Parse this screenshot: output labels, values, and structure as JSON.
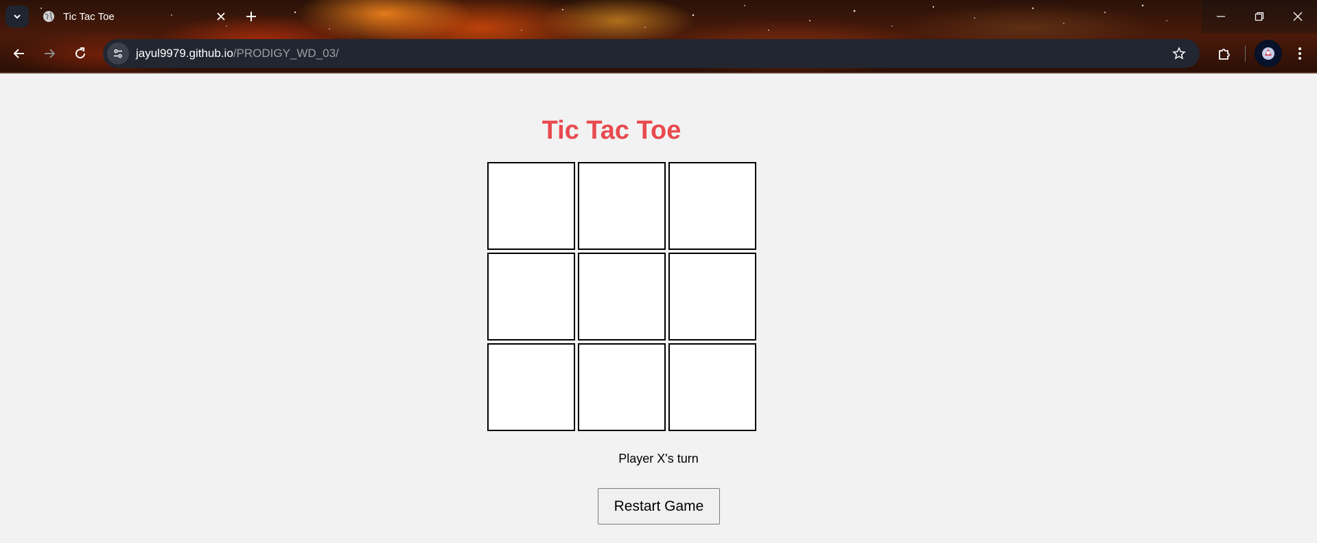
{
  "browser": {
    "tab_title": "Tic Tac Toe",
    "url_host": "jayul9979.github.io",
    "url_path": "/PRODIGY_WD_03/"
  },
  "game": {
    "title": "Tic Tac Toe",
    "cells": [
      "",
      "",
      "",
      "",
      "",
      "",
      "",
      "",
      ""
    ],
    "status": "Player X's turn",
    "restart_label": "Restart Game"
  },
  "colors": {
    "title": "#e84a4f",
    "page_bg": "#f2f2f2",
    "omnibox_bg": "#212630"
  }
}
